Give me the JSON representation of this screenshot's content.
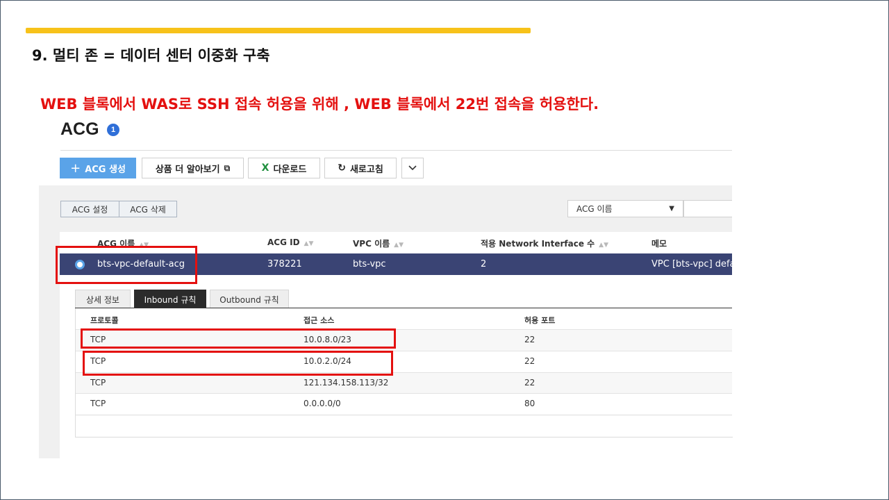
{
  "slide": {
    "title": "9. 멀티 존 = 데이터 센터 이중화 구축",
    "headline": "WEB 블록에서 WAS로 SSH 접속 허용을 위해 , WEB 블록에서 22번 접속을 허용한다."
  },
  "colors": {
    "accent_bar": "#f7c21a",
    "headline": "#e4100f",
    "highlight_box": "#e4100f",
    "selected_row": "#3a4474",
    "primary_button": "#5aa3e8"
  },
  "page": {
    "title": "ACG",
    "badge": "1"
  },
  "toolbar": {
    "create_label": "ACG 생성",
    "learn_more_label": "상품 더 알아보기",
    "download_label": "다운로드",
    "refresh_label": "새로고침",
    "more_icon": "chevron-down-icon"
  },
  "actions": {
    "settings_label": "ACG 설정",
    "delete_label": "ACG 삭제"
  },
  "filter": {
    "selected": "ACG 이름",
    "value": ""
  },
  "table": {
    "columns": [
      "ACG 이름",
      "ACG ID",
      "VPC 이름",
      "적용 Network Interface 수",
      "메모"
    ],
    "rows": [
      {
        "name": "bts-vpc-default-acg",
        "id": "378221",
        "vpc": "bts-vpc",
        "ni_count": "2",
        "memo": "VPC [bts-vpc] defaul"
      }
    ]
  },
  "tabs": [
    "상세 정보",
    "Inbound 규칙",
    "Outbound 규칙"
  ],
  "active_tab": "Inbound 규칙",
  "inbound": {
    "columns": [
      "프로토콜",
      "접근 소스",
      "허용 포트"
    ],
    "rows": [
      {
        "protocol": "TCP",
        "source": "10.0.8.0/23",
        "port": "22"
      },
      {
        "protocol": "TCP",
        "source": "10.0.2.0/24",
        "port": "22"
      },
      {
        "protocol": "TCP",
        "source": "121.134.158.113/32",
        "port": "22"
      },
      {
        "protocol": "TCP",
        "source": "0.0.0.0/0",
        "port": "80"
      }
    ]
  }
}
